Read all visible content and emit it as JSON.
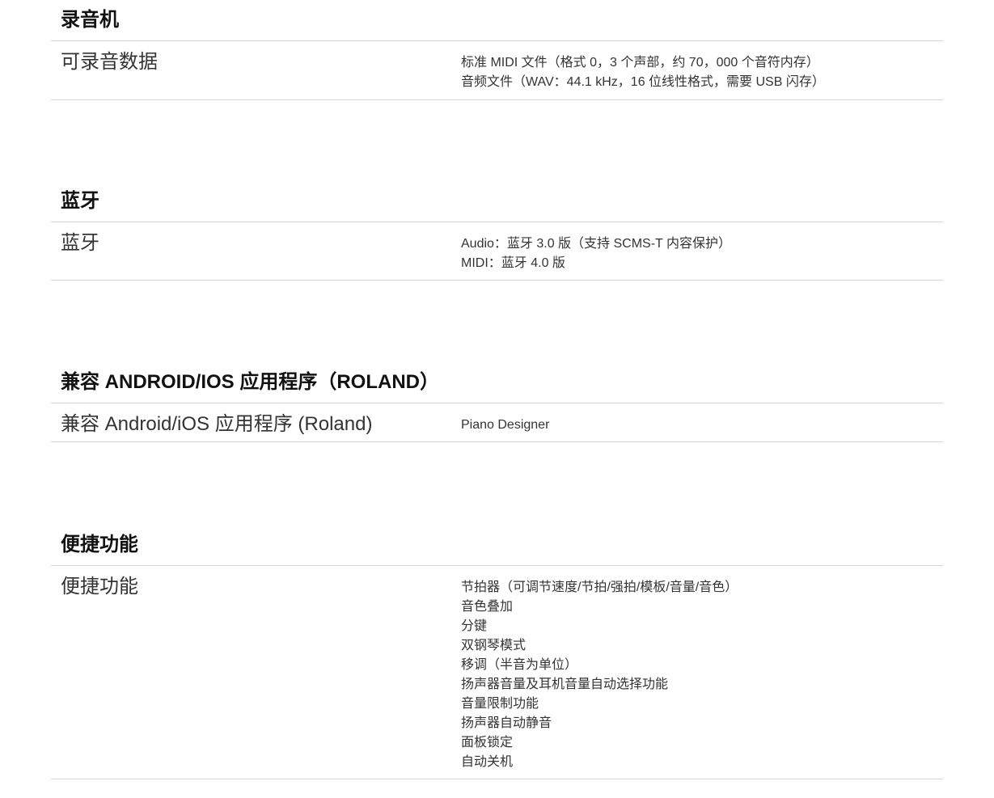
{
  "sections": [
    {
      "title": "录音机",
      "rows": [
        {
          "label": "可录音数据",
          "values": [
            "标准 MIDI 文件（格式 0，3 个声部，约 70，000 个音符内存）",
            "音频文件（WAV：44.1 kHz，16 位线性格式，需要 USB 闪存）"
          ]
        }
      ]
    },
    {
      "title": "蓝牙",
      "rows": [
        {
          "label": "蓝牙",
          "values": [
            "Audio：蓝牙 3.0 版（支持 SCMS-T 内容保护）",
            "MIDI：蓝牙 4.0 版"
          ]
        }
      ]
    },
    {
      "title": "兼容 ANDROID/IOS 应用程序（ROLAND）",
      "rows": [
        {
          "label": "兼容 Android/iOS 应用程序 (Roland)",
          "values": [
            "Piano Designer"
          ]
        }
      ]
    },
    {
      "title": "便捷功能",
      "rows": [
        {
          "label": "便捷功能",
          "values": [
            "节拍器（可调节速度/节拍/强拍/模板/音量/音色）",
            "音色叠加",
            "分键",
            "双钢琴模式",
            "移调（半音为单位）",
            "扬声器音量及耳机音量自动选择功能",
            "音量限制功能",
            "扬声器自动静音",
            "面板锁定",
            "自动关机"
          ]
        }
      ]
    }
  ]
}
